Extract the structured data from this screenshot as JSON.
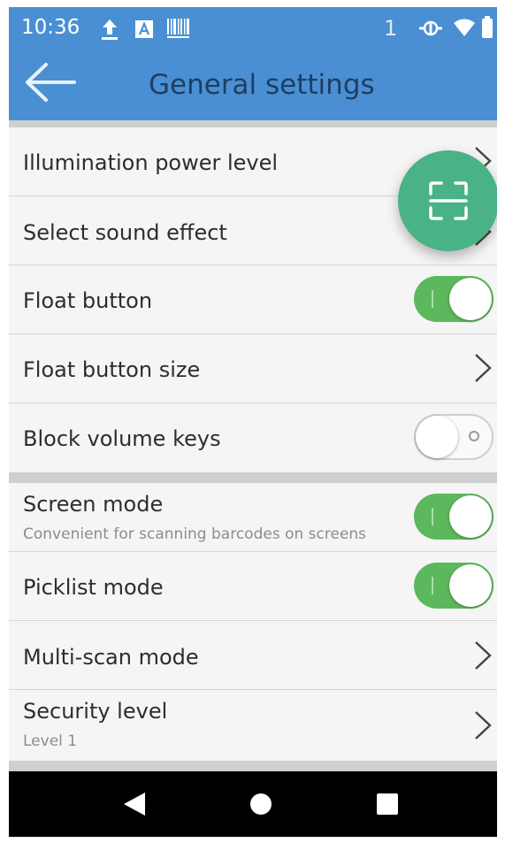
{
  "status_bar": {
    "time": "10:36",
    "notification_count": "1",
    "icons": [
      "upload-icon",
      "a-box-icon",
      "barcode-icon",
      "data-saver-icon",
      "wifi-icon",
      "battery-icon"
    ]
  },
  "toolbar": {
    "title": "General settings",
    "back_icon": "arrow-left-icon"
  },
  "settings": {
    "illumination": {
      "label": "Illumination power level"
    },
    "sound": {
      "label": "Select sound effect"
    },
    "float_button": {
      "label": "Float button",
      "enabled": true
    },
    "float_button_size": {
      "label": "Float button size"
    },
    "block_volume": {
      "label": "Block volume keys",
      "enabled": false
    },
    "screen_mode": {
      "label": "Screen mode",
      "sub": "Convenient for scanning barcodes on screens",
      "enabled": true
    },
    "picklist": {
      "label": "Picklist mode",
      "enabled": true
    },
    "multiscan": {
      "label": "Multi-scan mode"
    },
    "security": {
      "label": "Security level",
      "sub": "Level 1"
    }
  },
  "floating_scan_button": {
    "icon": "scan-frame-icon"
  },
  "nav_bar": {
    "icons": [
      "back-triangle-icon",
      "home-circle-icon",
      "recents-square-icon"
    ]
  },
  "colors": {
    "app_bar": "#4a8fd3",
    "toggle_on": "#5cb85c",
    "fab": "#49b286"
  }
}
